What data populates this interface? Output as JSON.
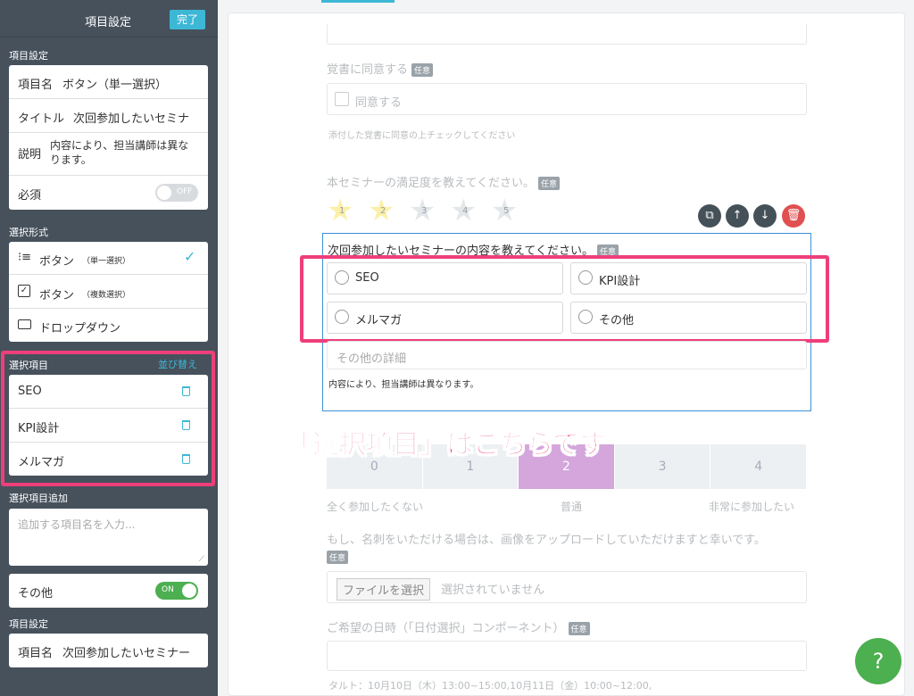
{
  "sidebar": {
    "header_title": "項目設定",
    "done_label": "完了",
    "item_settings_label": "項目設定",
    "item_name_key": "項目名",
    "item_name_value": "ボタン（単一選択）",
    "title_key": "タイトル",
    "title_value": "次回参加したいセミナ",
    "desc_key": "説明",
    "desc_value": "内容により、担当講師は異なります。",
    "required_key": "必須",
    "required_toggle": "OFF",
    "select_format_label": "選択形式",
    "formats": [
      {
        "label": "ボタン",
        "sub": "（単一選択）"
      },
      {
        "label": "ボタン",
        "sub": "（複数選択）"
      },
      {
        "label": "ドロップダウン",
        "sub": ""
      }
    ],
    "choices_label": "選択項目",
    "sort_label": "並び替え",
    "choices": [
      "SEO",
      "KPI設計",
      "メルマガ"
    ],
    "add_choice_label": "選択項目追加",
    "add_choice_placeholder": "追加する項目名を入力...",
    "other_key": "その他",
    "other_toggle": "ON",
    "item_settings2_label": "項目設定",
    "item_name2_key": "項目名",
    "item_name2_value": "次回参加したいセミナー"
  },
  "main": {
    "agree_title": "覚書に同意する",
    "optional_tag": "任意",
    "agree_checkbox": "同意する",
    "agree_help": "添付した覚書に同意の上チェックしてください",
    "satisfaction_title": "本セミナーの満足度を教えてください。",
    "stars": [
      "1",
      "2",
      "3",
      "4",
      "5"
    ],
    "star_selected_count": 2,
    "question_title": "次回参加したいセミナーの内容を教えてください。",
    "options": [
      "SEO",
      "KPI設計",
      "メルマガ",
      "その他"
    ],
    "other_detail_placeholder": "その他の詳細",
    "question_desc": "内容により、担当講師は異なります。",
    "annotation": "「選択項目」はこちらです",
    "scale_values": [
      "0",
      "1",
      "2",
      "3",
      "4"
    ],
    "scale_selected": 2,
    "scale_left": "全く参加したくない",
    "scale_mid": "普通",
    "scale_right": "非常に参加したい",
    "upload_title": "もし、名刺をいただける場合は、画像をアップロードしていただけますと幸いです。",
    "file_button": "ファイルを選択",
    "file_status": "選択されていません",
    "date_title": "ご希望の日時（「日付選択」コンポーネント）",
    "date_help": "タルト：10月10日（木）13:00~15:00,10月11日（金）10:00~12:00,",
    "help_button": "?"
  },
  "colors": {
    "sidebar_bg": "#46515c",
    "accent": "#3db7d6",
    "highlight": "#ee3f7a",
    "toggle_on": "#4caf50",
    "scale_selected": "#d4a6dc",
    "question_border": "#3d8fd6",
    "delete_button": "#e05050"
  }
}
